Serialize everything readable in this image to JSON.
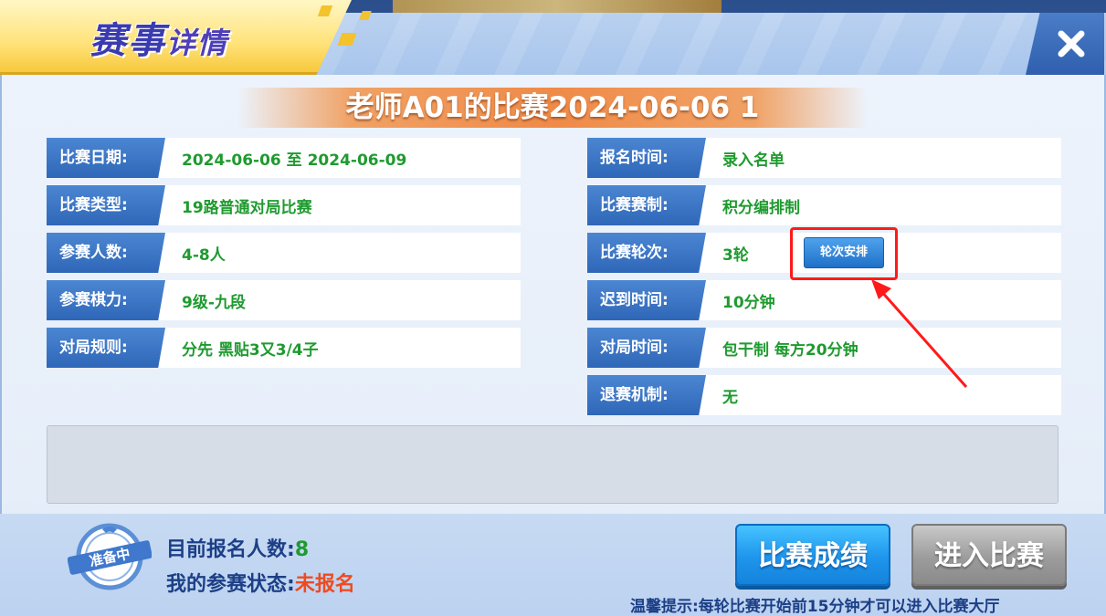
{
  "window": {
    "title_main": "赛事",
    "title_sub": "详情"
  },
  "match": {
    "title": "老师A01的比赛2024-06-06 1"
  },
  "left_fields": [
    {
      "label": "比赛日期:",
      "value": "2024-06-06 至 2024-06-09"
    },
    {
      "label": "比赛类型:",
      "value": "19路普通对局比赛"
    },
    {
      "label": "参赛人数:",
      "value": "4-8人"
    },
    {
      "label": "参赛棋力:",
      "value": "9级-九段"
    },
    {
      "label": "对局规则:",
      "value": "分先 黑贴3又3/4子"
    }
  ],
  "right_fields": [
    {
      "label": "报名时间:",
      "value": "录入名单"
    },
    {
      "label": "比赛赛制:",
      "value": "积分编排制"
    },
    {
      "label": "比赛轮次:",
      "value": "3轮"
    },
    {
      "label": "迟到时间:",
      "value": "10分钟"
    },
    {
      "label": "对局时间:",
      "value": "包干制 每方20分钟"
    },
    {
      "label": "退赛机制:",
      "value": "无"
    }
  ],
  "round_schedule_button": "轮次安排",
  "status_stamp": "准备中",
  "registration": {
    "count_label": "目前报名人数:",
    "count_value": "8",
    "status_label": "我的参赛状态:",
    "status_value": "未报名"
  },
  "buttons": {
    "results": "比赛成绩",
    "enter": "进入比赛"
  },
  "tip": "温馨提示:每轮比赛开始前15分钟才可以进入比赛大厅",
  "colors": {
    "label_blue": "#2f67b8",
    "value_green": "#1f9a2f",
    "status_red": "#ef4a1f",
    "highlight_red": "#ff1a1a",
    "title_orange": "#ef8a48"
  }
}
